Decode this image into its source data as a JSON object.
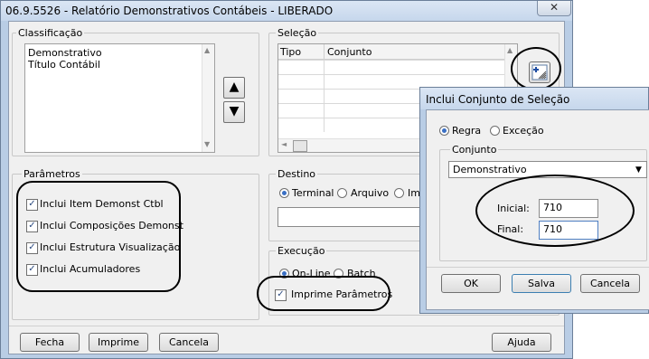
{
  "main": {
    "title": "06.9.5526 - Relatório Demonstrativos Contábeis - LIBERADO",
    "classificacao": {
      "label": "Classificação",
      "items": [
        "Demonstrativo",
        "Título Contábil"
      ]
    },
    "selecao": {
      "label": "Seleção",
      "col_tipo": "Tipo",
      "col_conjunto": "Conjunto"
    },
    "parametros": {
      "label": "Parâmetros",
      "items": [
        "Inclui Item Demonst Ctbl",
        "Inclui Composições Demonst",
        "Inclui Estrutura Visualização",
        "Inclui Acumuladores"
      ]
    },
    "destino": {
      "label": "Destino",
      "terminal": "Terminal",
      "arquivo": "Arquivo",
      "impressora": "Imp"
    },
    "execucao": {
      "label": "Execução",
      "online": "On-Line",
      "batch": "Batch",
      "imprime_parametros": "Imprime Parâmetros"
    },
    "buttons": {
      "fecha": "Fecha",
      "imprime": "Imprime",
      "cancela": "Cancela",
      "ajuda": "Ajuda"
    }
  },
  "dialog": {
    "title": "Inclui Conjunto de Seleção",
    "regra": "Regra",
    "excecao": "Exceção",
    "conjunto_label": "Conjunto",
    "conjunto_value": "Demonstrativo",
    "inicial_label": "Inicial:",
    "inicial_value": "710",
    "final_label": "Final:",
    "final_value": "710",
    "ok": "OK",
    "salva": "Salva",
    "cancela": "Cancela"
  },
  "colors": {
    "window_frame": "#b9cde5",
    "client_bg": "#f0f0f0",
    "accent": "#3a6fc4"
  }
}
